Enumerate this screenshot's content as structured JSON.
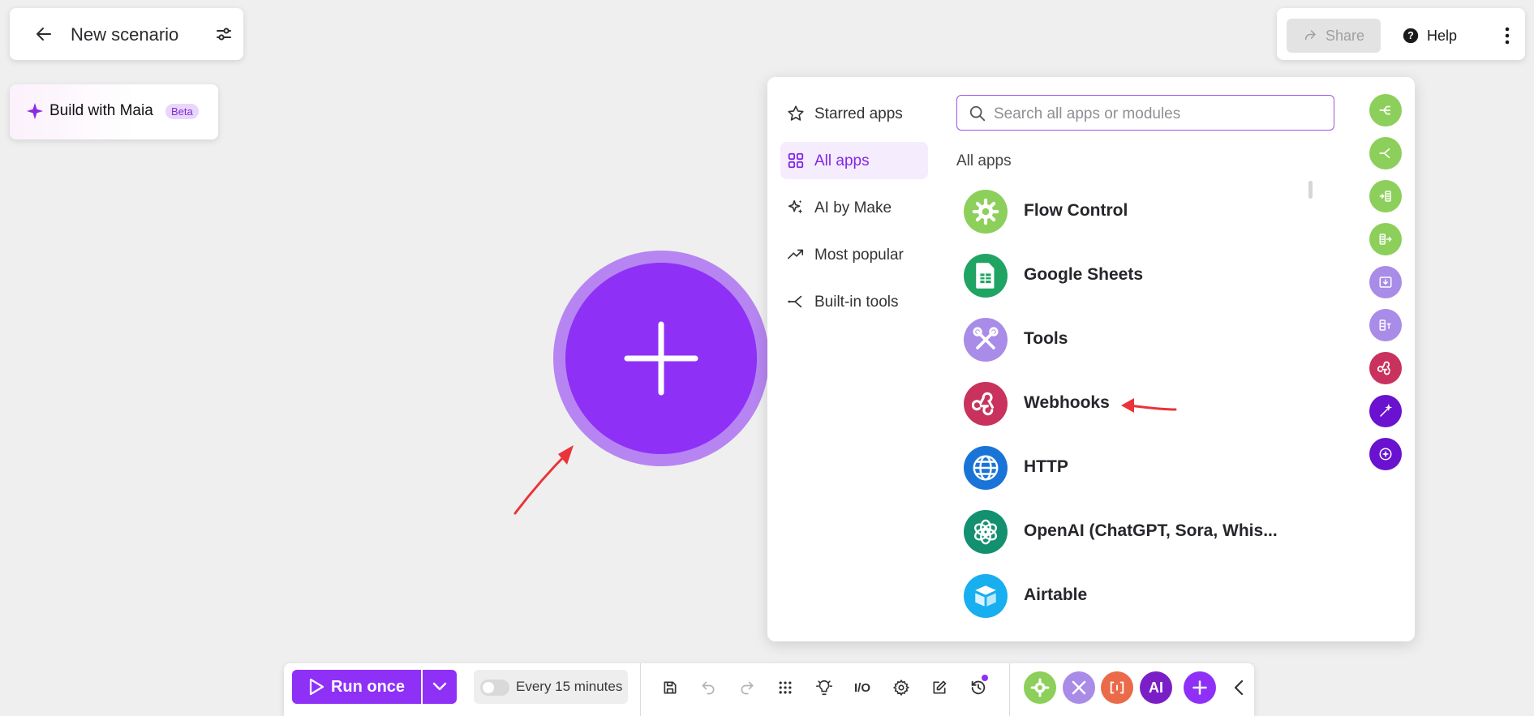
{
  "header": {
    "title": "New scenario",
    "maia_label": "Build with Maia",
    "maia_badge": "Beta"
  },
  "topbar": {
    "share_label": "Share",
    "help_label": "Help"
  },
  "panel": {
    "nav_items": [
      {
        "label": "Starred apps",
        "icon": "star-icon"
      },
      {
        "label": "All apps",
        "icon": "grid-icon",
        "active": true
      },
      {
        "label": "AI by Make",
        "icon": "sparkles-icon"
      },
      {
        "label": "Most popular",
        "icon": "trending-icon"
      },
      {
        "label": "Built-in tools",
        "icon": "tools-branch-icon"
      }
    ],
    "search_placeholder": "Search all apps or modules",
    "heading": "All apps",
    "apps": [
      {
        "name": "Flow Control",
        "icon": "gear-icon",
        "color": "#8ccf5a"
      },
      {
        "name": "Google Sheets",
        "icon": "google-sheets-icon",
        "color": "#1fa463"
      },
      {
        "name": "Tools",
        "icon": "tools-icon",
        "color": "#a98be8"
      },
      {
        "name": "Webhooks",
        "icon": "webhook-icon",
        "color": "#c8325c"
      },
      {
        "name": "HTTP",
        "icon": "globe-icon",
        "color": "#1a74d8"
      },
      {
        "name": "OpenAI (ChatGPT, Sora, Whis...",
        "icon": "openai-icon",
        "color": "#12906f"
      },
      {
        "name": "Airtable",
        "icon": "airtable-icon",
        "color": "#18aff0"
      }
    ]
  },
  "toolbar": {
    "run_label": "Run once",
    "schedule_label": "Every 15 minutes",
    "io_label": "I/O",
    "ai_label": "AI"
  },
  "colors": {
    "accent": "#8f30f7",
    "flow_green": "#8ccf5a",
    "annotation_red": "#e8343a"
  }
}
